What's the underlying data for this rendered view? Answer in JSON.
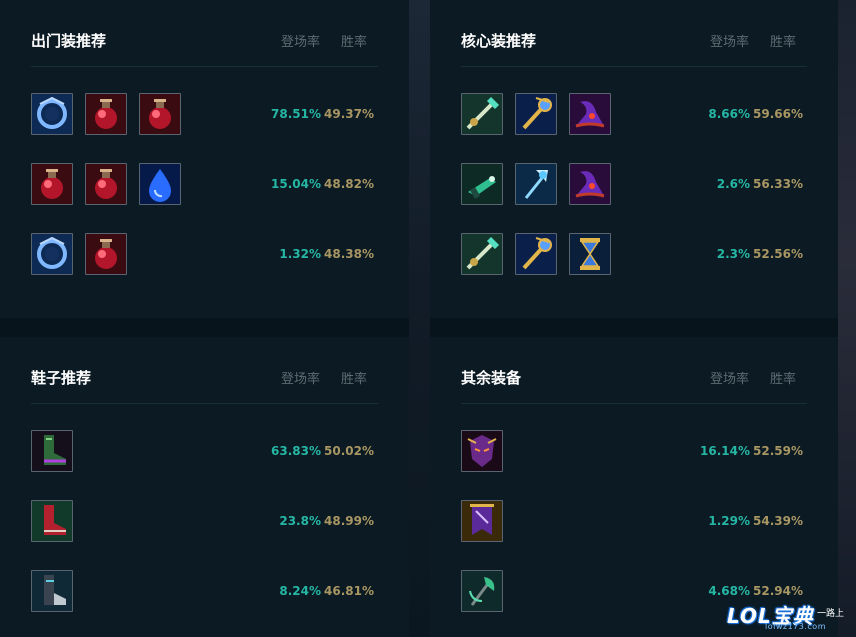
{
  "panels": [
    {
      "id": "starter",
      "title": "出门装推荐",
      "col_pick": "登场率",
      "col_win": "胜率",
      "rows": [
        {
          "icons": [
            "shield-ring-icon",
            "red-potion-icon",
            "red-potion-icon"
          ],
          "pick": "78.51%",
          "win": "49.37%"
        },
        {
          "icons": [
            "red-potion-icon",
            "red-potion-icon",
            "blue-tear-icon"
          ],
          "pick": "15.04%",
          "win": "48.82%"
        },
        {
          "icons": [
            "shield-ring-icon",
            "red-potion-icon"
          ],
          "pick": "1.32%",
          "win": "48.38%"
        }
      ]
    },
    {
      "id": "core",
      "title": "核心装推荐",
      "col_pick": "登场率",
      "col_win": "胜率",
      "rows": [
        {
          "icons": [
            "trident-staff-icon",
            "golden-scepter-icon",
            "purple-hat-icon"
          ],
          "pick": "8.66%",
          "win": "59.66%"
        },
        {
          "icons": [
            "green-gun-icon",
            "ice-staff-icon",
            "purple-hat-icon"
          ],
          "pick": "2.6%",
          "win": "56.33%"
        },
        {
          "icons": [
            "trident-staff-icon",
            "golden-scepter-icon",
            "hourglass-icon"
          ],
          "pick": "2.3%",
          "win": "52.56%"
        }
      ]
    },
    {
      "id": "boots",
      "title": "鞋子推荐",
      "col_pick": "登场率",
      "col_win": "胜率",
      "rows": [
        {
          "icons": [
            "green-boots-icon"
          ],
          "pick": "63.83%",
          "win": "50.02%"
        },
        {
          "icons": [
            "red-boots-icon"
          ],
          "pick": "23.8%",
          "win": "48.99%"
        },
        {
          "icons": [
            "steel-boots-icon"
          ],
          "pick": "8.24%",
          "win": "46.81%"
        }
      ]
    },
    {
      "id": "other",
      "title": "其余装备",
      "col_pick": "登场率",
      "col_win": "胜率",
      "rows": [
        {
          "icons": [
            "dark-mask-icon"
          ],
          "pick": "16.14%",
          "win": "52.59%"
        },
        {
          "icons": [
            "purple-banner-icon"
          ],
          "pick": "1.29%",
          "win": "54.39%"
        },
        {
          "icons": [
            "green-axe-icon"
          ],
          "pick": "4.68%",
          "win": "52.94%"
        }
      ]
    }
  ],
  "watermark": {
    "logo": "LOL宝典",
    "tag": "一路上",
    "url": "lolwz173.com"
  },
  "colors": {
    "pick": "#26b6a4",
    "win": "#a89663",
    "panel": "#0b1a23",
    "bg": "#07141c"
  }
}
